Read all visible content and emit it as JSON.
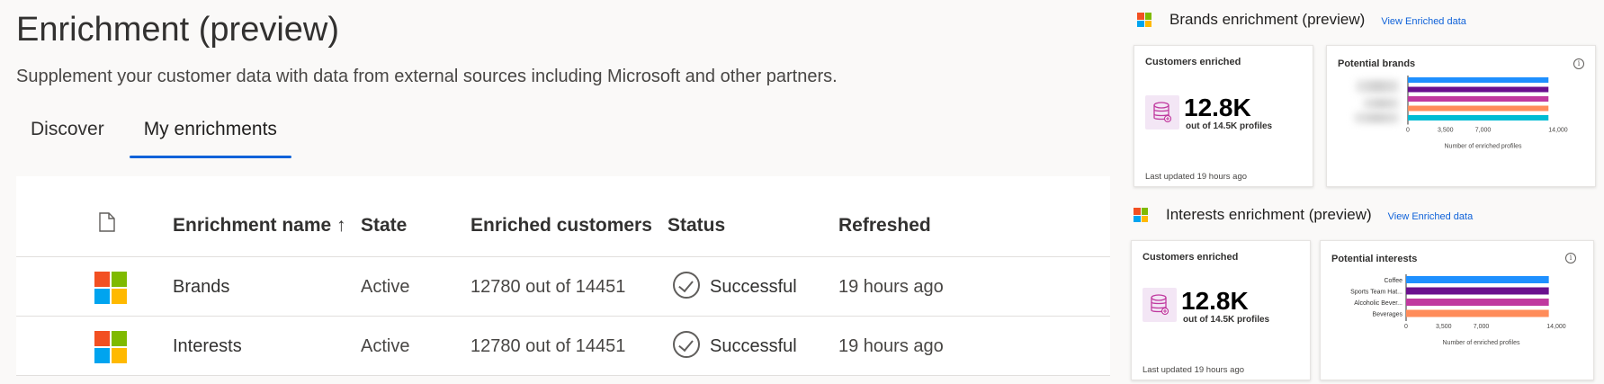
{
  "page": {
    "title": "Enrichment (preview)",
    "description": "Supplement your customer data with data from external sources including Microsoft and other partners."
  },
  "tabs": [
    {
      "label": "Discover",
      "selected": false
    },
    {
      "label": "My enrichments",
      "selected": true
    }
  ],
  "table": {
    "headers": {
      "name": "Enrichment name ↑",
      "state": "State",
      "enriched": "Enriched customers",
      "status": "Status",
      "refreshed": "Refreshed"
    },
    "rows": [
      {
        "name": "Brands",
        "state": "Active",
        "enriched": "12780 out of 14451",
        "status": "Successful",
        "refreshed": "19 hours ago"
      },
      {
        "name": "Interests",
        "state": "Active",
        "enriched": "12780 out of 14451",
        "status": "Successful",
        "refreshed": "19 hours ago"
      }
    ]
  },
  "brands_panel": {
    "title": "Brands enrichment (preview)",
    "link": "View Enriched data",
    "customers_card": {
      "label": "Customers enriched",
      "value": "12.8K",
      "sub": "out of 14.5K profiles",
      "updated": "Last updated 19 hours ago"
    },
    "chart_card": {
      "label": "Potential brands",
      "xlabel": "Number of enriched profiles"
    }
  },
  "interests_panel": {
    "title": "Interests enrichment (preview)",
    "link": "View Enriched data",
    "customers_card": {
      "label": "Customers enriched",
      "value": "12.8K",
      "sub": "out of 14.5K profiles",
      "updated": "Last updated 19 hours ago"
    },
    "chart_card": {
      "label": "Potential interests",
      "xlabel": "Number of enriched profiles"
    }
  },
  "colors": {
    "accent": "#0f62d9",
    "bar_colors": [
      "#1e90ff",
      "#6a0f8e",
      "#c0399f",
      "#ff8c5a",
      "#00bcd4"
    ]
  },
  "chart_data": [
    {
      "type": "bar",
      "orientation": "horizontal",
      "title": "Potential brands",
      "categories": [
        "",
        "",
        "",
        "",
        ""
      ],
      "values": [
        13100,
        13100,
        13100,
        13100,
        13100
      ],
      "xlabel": "Number of enriched profiles",
      "xticks": [
        "0",
        "3,500",
        "7,000",
        "14,000"
      ],
      "xlim": [
        0,
        14000
      ]
    },
    {
      "type": "bar",
      "orientation": "horizontal",
      "title": "Potential interests",
      "categories": [
        "Coffee",
        "Sports Team Hat...",
        "Alcoholic Bever...",
        "Beverages"
      ],
      "values": [
        13300,
        13300,
        13300,
        13300
      ],
      "xlabel": "Number of enriched profiles",
      "xticks": [
        "0",
        "3,500",
        "7,000",
        "14,000"
      ],
      "xlim": [
        0,
        14000
      ]
    }
  ]
}
